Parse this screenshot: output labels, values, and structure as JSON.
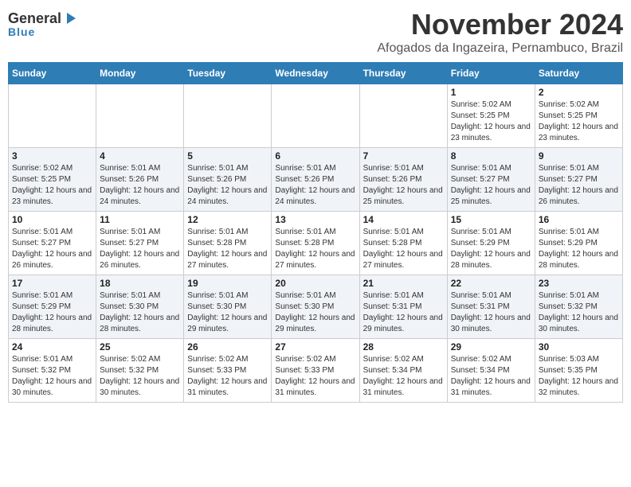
{
  "header": {
    "logo_general": "General",
    "logo_blue": "Blue",
    "month_title": "November 2024",
    "location": "Afogados da Ingazeira, Pernambuco, Brazil"
  },
  "calendar": {
    "weekdays": [
      "Sunday",
      "Monday",
      "Tuesday",
      "Wednesday",
      "Thursday",
      "Friday",
      "Saturday"
    ],
    "weeks": [
      [
        {
          "day": "",
          "info": ""
        },
        {
          "day": "",
          "info": ""
        },
        {
          "day": "",
          "info": ""
        },
        {
          "day": "",
          "info": ""
        },
        {
          "day": "",
          "info": ""
        },
        {
          "day": "1",
          "info": "Sunrise: 5:02 AM\nSunset: 5:25 PM\nDaylight: 12 hours and 23 minutes."
        },
        {
          "day": "2",
          "info": "Sunrise: 5:02 AM\nSunset: 5:25 PM\nDaylight: 12 hours and 23 minutes."
        }
      ],
      [
        {
          "day": "3",
          "info": "Sunrise: 5:02 AM\nSunset: 5:25 PM\nDaylight: 12 hours and 23 minutes."
        },
        {
          "day": "4",
          "info": "Sunrise: 5:01 AM\nSunset: 5:26 PM\nDaylight: 12 hours and 24 minutes."
        },
        {
          "day": "5",
          "info": "Sunrise: 5:01 AM\nSunset: 5:26 PM\nDaylight: 12 hours and 24 minutes."
        },
        {
          "day": "6",
          "info": "Sunrise: 5:01 AM\nSunset: 5:26 PM\nDaylight: 12 hours and 24 minutes."
        },
        {
          "day": "7",
          "info": "Sunrise: 5:01 AM\nSunset: 5:26 PM\nDaylight: 12 hours and 25 minutes."
        },
        {
          "day": "8",
          "info": "Sunrise: 5:01 AM\nSunset: 5:27 PM\nDaylight: 12 hours and 25 minutes."
        },
        {
          "day": "9",
          "info": "Sunrise: 5:01 AM\nSunset: 5:27 PM\nDaylight: 12 hours and 26 minutes."
        }
      ],
      [
        {
          "day": "10",
          "info": "Sunrise: 5:01 AM\nSunset: 5:27 PM\nDaylight: 12 hours and 26 minutes."
        },
        {
          "day": "11",
          "info": "Sunrise: 5:01 AM\nSunset: 5:27 PM\nDaylight: 12 hours and 26 minutes."
        },
        {
          "day": "12",
          "info": "Sunrise: 5:01 AM\nSunset: 5:28 PM\nDaylight: 12 hours and 27 minutes."
        },
        {
          "day": "13",
          "info": "Sunrise: 5:01 AM\nSunset: 5:28 PM\nDaylight: 12 hours and 27 minutes."
        },
        {
          "day": "14",
          "info": "Sunrise: 5:01 AM\nSunset: 5:28 PM\nDaylight: 12 hours and 27 minutes."
        },
        {
          "day": "15",
          "info": "Sunrise: 5:01 AM\nSunset: 5:29 PM\nDaylight: 12 hours and 28 minutes."
        },
        {
          "day": "16",
          "info": "Sunrise: 5:01 AM\nSunset: 5:29 PM\nDaylight: 12 hours and 28 minutes."
        }
      ],
      [
        {
          "day": "17",
          "info": "Sunrise: 5:01 AM\nSunset: 5:29 PM\nDaylight: 12 hours and 28 minutes."
        },
        {
          "day": "18",
          "info": "Sunrise: 5:01 AM\nSunset: 5:30 PM\nDaylight: 12 hours and 28 minutes."
        },
        {
          "day": "19",
          "info": "Sunrise: 5:01 AM\nSunset: 5:30 PM\nDaylight: 12 hours and 29 minutes."
        },
        {
          "day": "20",
          "info": "Sunrise: 5:01 AM\nSunset: 5:30 PM\nDaylight: 12 hours and 29 minutes."
        },
        {
          "day": "21",
          "info": "Sunrise: 5:01 AM\nSunset: 5:31 PM\nDaylight: 12 hours and 29 minutes."
        },
        {
          "day": "22",
          "info": "Sunrise: 5:01 AM\nSunset: 5:31 PM\nDaylight: 12 hours and 30 minutes."
        },
        {
          "day": "23",
          "info": "Sunrise: 5:01 AM\nSunset: 5:32 PM\nDaylight: 12 hours and 30 minutes."
        }
      ],
      [
        {
          "day": "24",
          "info": "Sunrise: 5:01 AM\nSunset: 5:32 PM\nDaylight: 12 hours and 30 minutes."
        },
        {
          "day": "25",
          "info": "Sunrise: 5:02 AM\nSunset: 5:32 PM\nDaylight: 12 hours and 30 minutes."
        },
        {
          "day": "26",
          "info": "Sunrise: 5:02 AM\nSunset: 5:33 PM\nDaylight: 12 hours and 31 minutes."
        },
        {
          "day": "27",
          "info": "Sunrise: 5:02 AM\nSunset: 5:33 PM\nDaylight: 12 hours and 31 minutes."
        },
        {
          "day": "28",
          "info": "Sunrise: 5:02 AM\nSunset: 5:34 PM\nDaylight: 12 hours and 31 minutes."
        },
        {
          "day": "29",
          "info": "Sunrise: 5:02 AM\nSunset: 5:34 PM\nDaylight: 12 hours and 31 minutes."
        },
        {
          "day": "30",
          "info": "Sunrise: 5:03 AM\nSunset: 5:35 PM\nDaylight: 12 hours and 32 minutes."
        }
      ]
    ]
  }
}
